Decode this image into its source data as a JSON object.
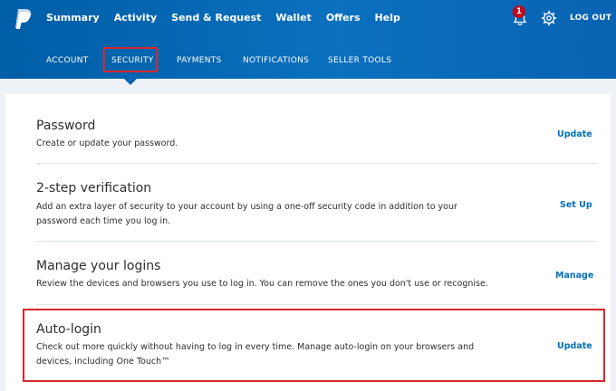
{
  "topnav": {
    "items": [
      "Summary",
      "Activity",
      "Send & Request",
      "Wallet",
      "Offers",
      "Help"
    ]
  },
  "notifications": {
    "count": "1"
  },
  "logout_label": "LOG OUT",
  "subnav": {
    "items": [
      "ACCOUNT",
      "SECURITY",
      "PAYMENTS",
      "NOTIFICATIONS",
      "SELLER TOOLS"
    ],
    "active": "SECURITY"
  },
  "settings": [
    {
      "title": "Password",
      "description": "Create or update your password.",
      "action": "Update"
    },
    {
      "title": "2-step verification",
      "description": "Add an extra layer of security to your account by using a one-off security code in addition to your password each time you log in.",
      "action": "Set Up"
    },
    {
      "title": "Manage your logins",
      "description": "Review the devices and browsers you use to log in. You can remove the ones you don't use or recognise.",
      "action": "Manage"
    },
    {
      "title": "Auto-login",
      "description": "Check out more quickly without having to log in every time. Manage auto-login on your browsers and devices, including One Touch™",
      "action": "Update"
    }
  ],
  "colors": {
    "header": "#0a63b3",
    "link": "#0070ba",
    "highlight": "#d9262b",
    "badge": "#c0061f"
  }
}
